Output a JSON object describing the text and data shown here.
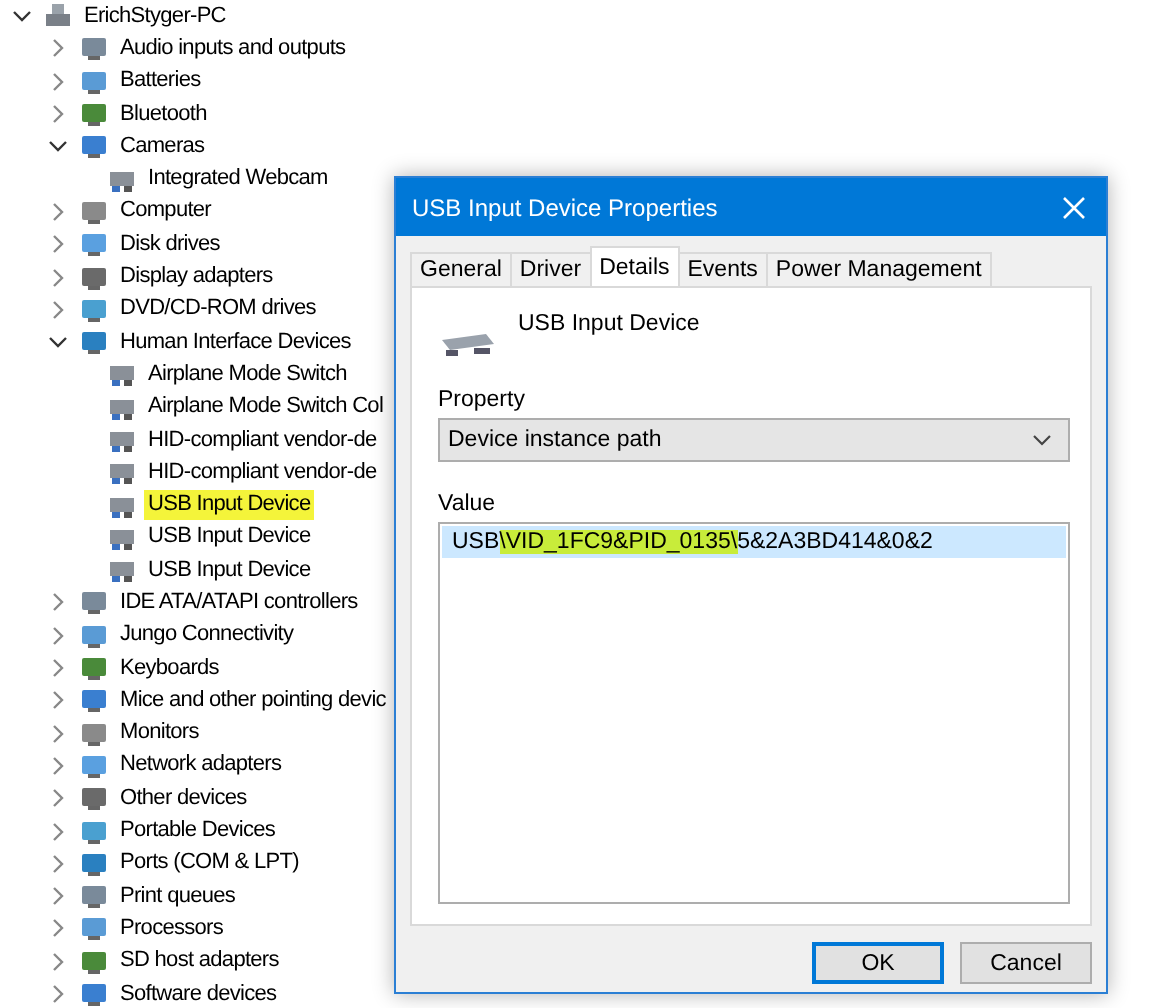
{
  "tree": {
    "label": "ErichStyger-PC",
    "expanded": true,
    "children": [
      {
        "label": "Audio inputs and outputs",
        "expanded": false
      },
      {
        "label": "Batteries",
        "expanded": false
      },
      {
        "label": "Bluetooth",
        "expanded": false
      },
      {
        "label": "Cameras",
        "expanded": true,
        "children": [
          {
            "label": "Integrated Webcam",
            "selected": false
          }
        ]
      },
      {
        "label": "Computer",
        "expanded": false
      },
      {
        "label": "Disk drives",
        "expanded": false
      },
      {
        "label": "Display adapters",
        "expanded": false
      },
      {
        "label": "DVD/CD-ROM drives",
        "expanded": false
      },
      {
        "label": "Human Interface Devices",
        "expanded": true,
        "children": [
          {
            "label": "Airplane Mode Switch",
            "selected": false
          },
          {
            "label": "Airplane Mode Switch Col",
            "selected": false
          },
          {
            "label": "HID-compliant vendor-de",
            "selected": false
          },
          {
            "label": "HID-compliant vendor-de",
            "selected": false
          },
          {
            "label": "USB Input Device",
            "selected": true
          },
          {
            "label": "USB Input Device",
            "selected": false
          },
          {
            "label": "USB Input Device",
            "selected": false
          }
        ]
      },
      {
        "label": "IDE ATA/ATAPI controllers",
        "expanded": false
      },
      {
        "label": "Jungo Connectivity",
        "expanded": false
      },
      {
        "label": "Keyboards",
        "expanded": false
      },
      {
        "label": "Mice and other pointing devic",
        "expanded": false
      },
      {
        "label": "Monitors",
        "expanded": false
      },
      {
        "label": "Network adapters",
        "expanded": false
      },
      {
        "label": "Other devices",
        "expanded": false
      },
      {
        "label": "Portable Devices",
        "expanded": false
      },
      {
        "label": "Ports (COM & LPT)",
        "expanded": false
      },
      {
        "label": "Print queues",
        "expanded": false
      },
      {
        "label": "Processors",
        "expanded": false
      },
      {
        "label": "SD host adapters",
        "expanded": false
      },
      {
        "label": "Software devices",
        "expanded": false
      }
    ]
  },
  "dialog": {
    "title": "USB Input Device Properties",
    "tabs": [
      {
        "label": "General",
        "selected": false
      },
      {
        "label": "Driver",
        "selected": false
      },
      {
        "label": "Details",
        "selected": true
      },
      {
        "label": "Events",
        "selected": false
      },
      {
        "label": "Power Management",
        "selected": false
      }
    ],
    "device_name": "USB Input Device",
    "property_label": "Property",
    "property_value": "Device instance path",
    "value_label": "Value",
    "values": [
      {
        "selected": true,
        "segments": [
          {
            "text": "USB",
            "highlight": false
          },
          {
            "text": "\\VID_1FC9&PID_0135\\",
            "highlight": true
          },
          {
            "text": "5&2A3BD414&0&2",
            "highlight": false
          }
        ]
      }
    ],
    "buttons": [
      {
        "label": "OK",
        "default": true
      },
      {
        "label": "Cancel",
        "default": false
      }
    ]
  }
}
